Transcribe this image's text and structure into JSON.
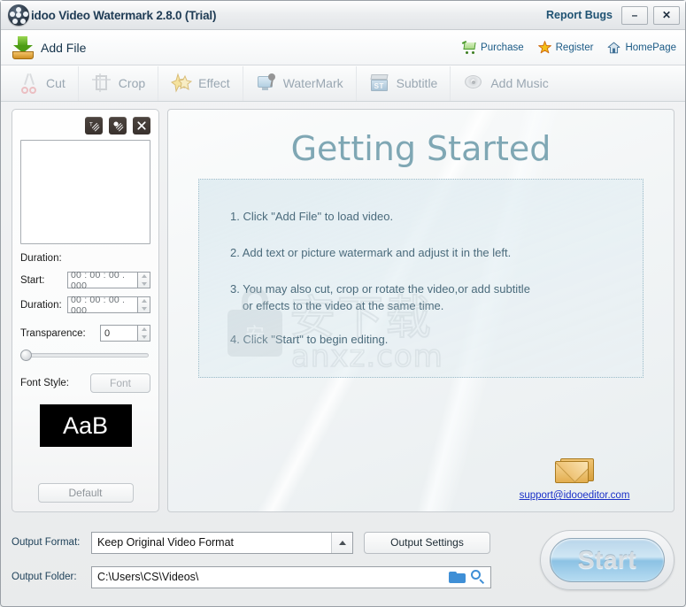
{
  "window": {
    "title": "idoo Video Watermark 2.8.0 (Trial)",
    "report_bugs": "Report Bugs",
    "minimize": "–",
    "close": "✕",
    "logo_icon": "film-reel-icon"
  },
  "toolbar_primary": {
    "add_file": "Add File",
    "links": [
      {
        "label": "Purchase",
        "icon": "shopping-cart-icon"
      },
      {
        "label": "Register",
        "icon": "star-icon"
      },
      {
        "label": "HomePage",
        "icon": "home-icon"
      }
    ]
  },
  "toolbar_secondary": {
    "items": [
      {
        "label": "Cut",
        "icon": "scissors-icon"
      },
      {
        "label": "Crop",
        "icon": "crop-icon"
      },
      {
        "label": "Effect",
        "icon": "star-burst-icon"
      },
      {
        "label": "WaterMark",
        "icon": "monitor-pin-icon"
      },
      {
        "label": "Subtitle",
        "icon": "clapperboard-st-icon"
      },
      {
        "label": "Add Music",
        "icon": "disc-icon"
      }
    ]
  },
  "left_panel": {
    "watermark_buttons": [
      {
        "name": "add-text-watermark-button",
        "icon": "text-watermark-icon"
      },
      {
        "name": "add-picture-watermark-button",
        "icon": "picture-watermark-icon"
      },
      {
        "name": "delete-watermark-button",
        "icon": "close-icon"
      }
    ],
    "duration_label": "Duration:",
    "start_label": "Start:",
    "start_value": "00 : 00 : 00 . 000",
    "duration_field_label": "Duration:",
    "duration_value": "00 : 00 : 00 . 000",
    "transparence_label": "Transparence:",
    "transparence_value": "0",
    "transparence_slider_position": "0",
    "font_style_label": "Font Style:",
    "font_button": "Font",
    "font_preview_text": "AaB",
    "default_button": "Default"
  },
  "main_panel": {
    "title": "Getting Started",
    "steps": [
      "1. Click \"Add File\" to load video.",
      "2. Add text or picture watermark and adjust it in the left.",
      "3. You may also cut, crop or rotate the video,or add subtitle"
    ],
    "step3_continued": "or effects to the video at the same time.",
    "step4": "4. Click \"Start\" to begin editing.",
    "support_email": "support@idooeditor.com",
    "support_icon": "envelope-icon",
    "overlay_watermark_chars": "安下载",
    "overlay_watermark_domain": "anxz.com",
    "overlay_lock_char": "安"
  },
  "bottom_bar": {
    "output_format_label": "Output Format:",
    "output_format_value": "Keep Original Video Format",
    "output_settings_button": "Output Settings",
    "output_folder_label": "Output Folder:",
    "output_folder_value": "C:\\Users\\CS\\Videos\\",
    "folder_icon": "folder-icon",
    "browse_icon": "search-icon",
    "start_button": "Start"
  },
  "colors": {
    "title_text": "#1f3c55",
    "link_blue": "#1c5b86",
    "getting_started": "#7fa7b4",
    "step_text": "#4b6b7c",
    "email_link": "#1a30c8",
    "start_button_fill": "#9fd0ea",
    "accent_icon_blue": "#3f8fd6"
  }
}
